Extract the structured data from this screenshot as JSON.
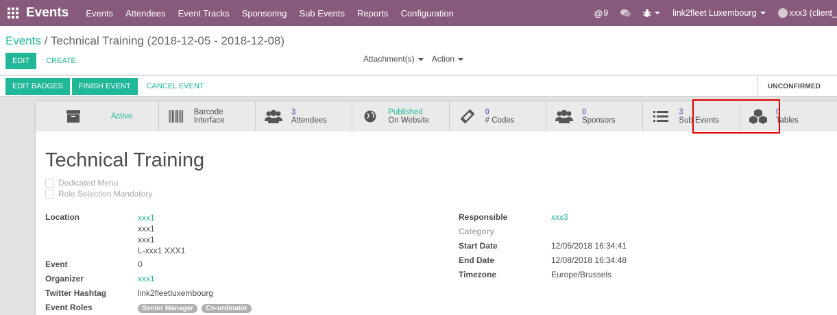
{
  "topbar": {
    "app_title": "Events",
    "menu": [
      "Events",
      "Attendees",
      "Event Tracks",
      "Sponsoring",
      "Sub Events",
      "Reports",
      "Configuration"
    ],
    "mentions_count": "9",
    "company": "link2fleet Luxembourg",
    "user": "xxx3 (client_"
  },
  "control_panel": {
    "breadcrumb_root": "Events",
    "breadcrumb_sep": "/",
    "breadcrumb_current": "Technical Training (2018-12-05 - 2018-12-08)",
    "edit_label": "EDIT",
    "create_label": "CREATE",
    "attachments_label": "Attachment(s)",
    "action_label": "Action"
  },
  "statusbar": {
    "edit_badges_label": "EDIT BADGES",
    "finish_event_label": "FINISH EVENT",
    "cancel_event_label": "CANCEL EVENT",
    "stage_label": "UNCONFIRMED"
  },
  "button_box": {
    "active": {
      "text": "Active"
    },
    "barcode": {
      "text": "Barcode Interface"
    },
    "attendees": {
      "num": "3",
      "text": "Attendees"
    },
    "website": {
      "line1": "Published",
      "line2": "On Website"
    },
    "codes": {
      "num": "0",
      "text": "# Codes"
    },
    "sponsors": {
      "num": "0",
      "text": "Sponsors"
    },
    "sub_events": {
      "num": "3",
      "text": "Sub Events"
    },
    "tables": {
      "num": "0",
      "text": "Tables"
    }
  },
  "form": {
    "title": "Technical Training",
    "dedicated_menu_label": "Dedicated Menu",
    "role_selection_label": "Role Selection Mandatory",
    "left": {
      "location_label": "Location",
      "location_lines": [
        "xxx1",
        "xxx1",
        "xxx1",
        "L-xxx1 XXX1"
      ],
      "event_label": "Event",
      "event_value": "0",
      "organizer_label": "Organizer",
      "organizer_value": "xxx1",
      "hashtag_label": "Twitter Hashtag",
      "hashtag_value": "link2fleetluxembourg",
      "roles_label": "Event Roles",
      "roles": [
        "Senior Manager",
        "Co-ordinator"
      ]
    },
    "right": {
      "responsible_label": "Responsible",
      "responsible_value": "xxx3",
      "category_label": "Category",
      "start_label": "Start Date",
      "start_value": "12/05/2018 16:34:41",
      "end_label": "End Date",
      "end_value": "12/08/2018 16:34:48",
      "timezone_label": "Timezone",
      "timezone_value": "Europe/Brussels"
    }
  },
  "colors": {
    "navbar": "#875a7b",
    "primary": "#21b799",
    "stat_number": "#7c7bad",
    "highlight": "#e20000"
  }
}
